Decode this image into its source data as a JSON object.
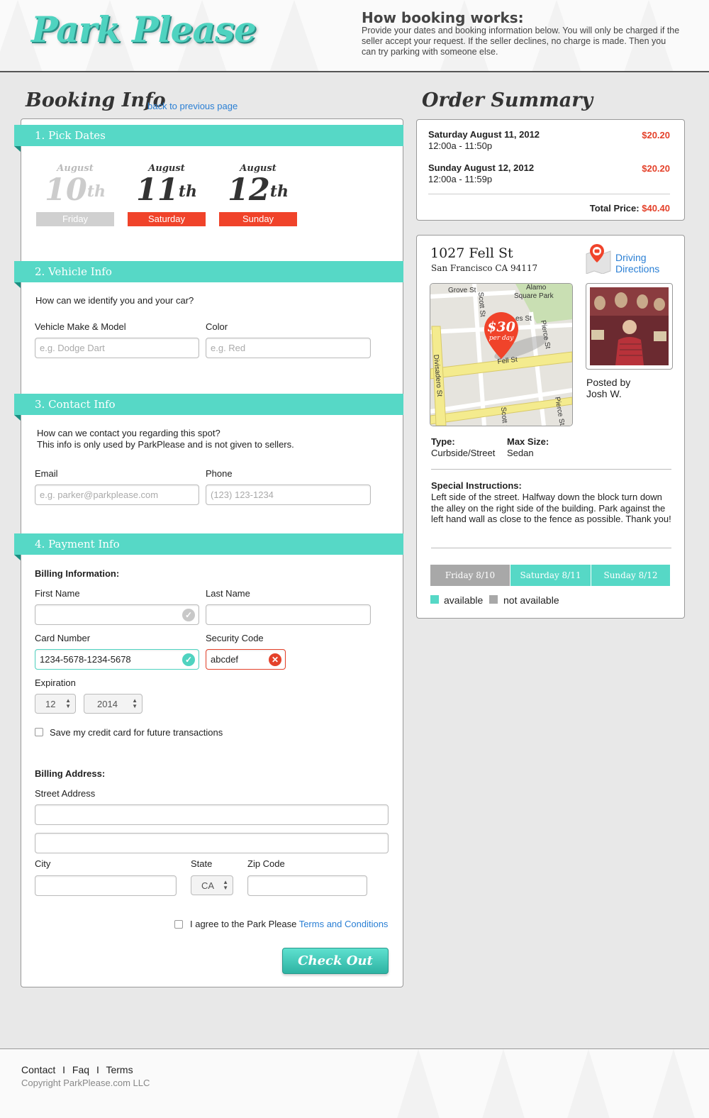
{
  "header": {
    "logo": "Park Please",
    "how_title": "How booking works:",
    "how_text": "Provide your dates and booking information below. You will only be charged if the seller accept your request. If the seller declines, no charge is made. Then you can try parking with someone else."
  },
  "booking": {
    "title": "Booking Info",
    "back_link": "back to previous page",
    "sections": {
      "dates": "1. Pick Dates",
      "vehicle": "2. Vehicle Info",
      "contact": "3. Contact Info",
      "payment": "4. Payment Info"
    },
    "dates": [
      {
        "month": "August",
        "day": "10",
        "suffix": "th",
        "weekday": "Friday",
        "selected": false
      },
      {
        "month": "August",
        "day": "11",
        "suffix": "th",
        "weekday": "Saturday",
        "selected": true
      },
      {
        "month": "August",
        "day": "12",
        "suffix": "th",
        "weekday": "Sunday",
        "selected": true
      }
    ],
    "vehicle": {
      "prompt": "How can we identify you and your car?",
      "make_label": "Vehicle Make & Model",
      "make_placeholder": "e.g. Dodge Dart",
      "color_label": "Color",
      "color_placeholder": "e.g. Red"
    },
    "contact": {
      "prompt_1": "How can we contact you regarding this spot?",
      "prompt_2": "This info is only used by ParkPlease and is not given to sellers.",
      "email_label": "Email",
      "email_placeholder": "e.g. parker@parkplease.com",
      "phone_label": "Phone",
      "phone_placeholder": "(123) 123-1234"
    },
    "payment": {
      "billing_info": "Billing Information:",
      "first_name_label": "First Name",
      "first_name_value": "",
      "last_name_label": "Last Name",
      "last_name_value": "",
      "card_label": "Card Number",
      "card_value": "1234-5678-1234-5678",
      "security_label": "Security Code",
      "security_value": "abcdef",
      "expiration_label": "Expiration",
      "exp_month": "12",
      "exp_year": "2014",
      "save_card": "Save my credit card for future transactions",
      "billing_address": "Billing Address:",
      "street_label": "Street Address",
      "city_label": "City",
      "state_label": "State",
      "state_value": "CA",
      "zip_label": "Zip Code",
      "agree_text": "I agree to the Park Please",
      "terms_link": "Terms and Conditions",
      "checkout": "Check Out"
    }
  },
  "order": {
    "title": "Order Summary",
    "items": [
      {
        "date": "Saturday August 11, 2012",
        "time": "12:00a - 11:50p",
        "price": "$20.20"
      },
      {
        "date": "Sunday August 12, 2012",
        "time": "12:00a - 11:59p",
        "price": "$20.20"
      }
    ],
    "total_label": "Total Price:",
    "total_value": "$40.40"
  },
  "listing": {
    "address": "1027 Fell St",
    "city": "San Francisco CA 94117",
    "directions": "Driving Directions",
    "map": {
      "streets": [
        "Grove St",
        "Alamo Square Park",
        "Scott St",
        "Hayes St",
        "Pierce St",
        "Divisadero St",
        "Fell St",
        "Scott St",
        "Pierce St"
      ],
      "pin_price": "$30",
      "pin_unit": "per day"
    },
    "posted_by": "Posted by",
    "poster": "Josh W.",
    "type_label": "Type:",
    "type_value": "Curbside/Street",
    "max_label": "Max Size:",
    "max_value": "Sedan",
    "instructions_label": "Special Instructions:",
    "instructions": "Left side of the street. Halfway down the block turn down the alley on the right side of the building. Park against the left hand wall as close to the fence as possible. Thank you!",
    "availability": [
      {
        "label": "Friday 8/10",
        "available": false
      },
      {
        "label": "Saturday 8/11",
        "available": true
      },
      {
        "label": "Sunday 8/12",
        "available": true
      }
    ],
    "legend_available": "available",
    "legend_unavailable": "not available"
  },
  "footer": {
    "links": [
      "Contact",
      "Faq",
      "Terms"
    ],
    "copyright": "Copyright ParkPlease.com LLC"
  },
  "colors": {
    "accent": "#56d8c6",
    "selected_day": "#f0432a",
    "unavailable": "#a8a8a8",
    "price": "#e4412a",
    "link": "#2a7fd4"
  }
}
